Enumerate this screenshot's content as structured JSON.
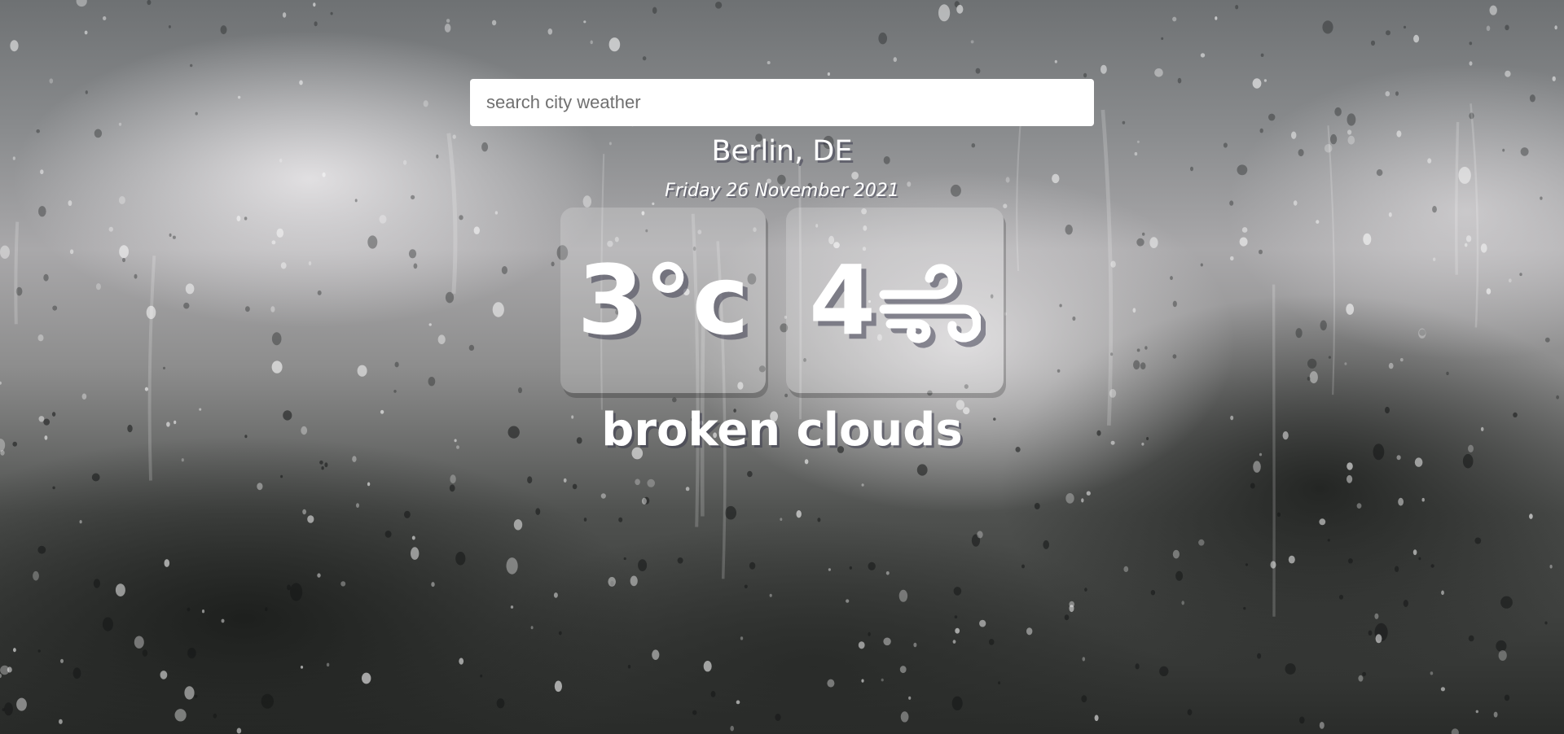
{
  "search": {
    "placeholder": "search city weather",
    "value": ""
  },
  "location": {
    "city_country": "Berlin, DE",
    "date": "Friday 26 November 2021"
  },
  "weather": {
    "temperature": "3°c",
    "wind_speed": "4",
    "wind_icon": "wind-icon",
    "description": "broken clouds"
  },
  "theme": {
    "text_color": "#ffffff",
    "background": "rainy-window-photo"
  }
}
